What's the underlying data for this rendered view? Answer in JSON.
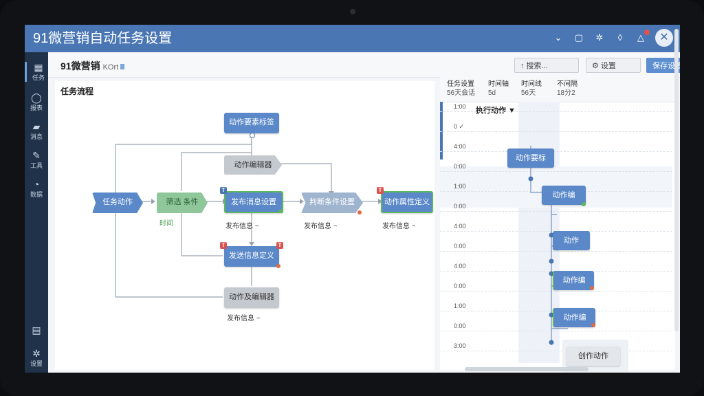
{
  "app": {
    "title": "91微营销自动任务设置"
  },
  "colors": {
    "titlebar": "#4a77b4",
    "node_blue": "#5a88c8",
    "node_gray": "#c4c9d0",
    "node_green": "#8fc79b",
    "sidebar": "#1f3249"
  },
  "titlebar_icons": [
    "chevron-down-icon",
    "tablet-icon",
    "settings-icon",
    "drop-icon",
    "bell-icon",
    "close-icon"
  ],
  "close_glyph": "✕",
  "sidebar": {
    "items": [
      {
        "icon": "▦",
        "label": "任务"
      },
      {
        "icon": "◯",
        "label": "报表"
      },
      {
        "icon": "▰",
        "label": "消息"
      },
      {
        "icon": "✎",
        "label": "工具"
      },
      {
        "icon": "◔",
        "label": "数据"
      }
    ],
    "bottom": [
      {
        "icon": "▤",
        "label": ""
      },
      {
        "icon": "✲",
        "label": "设置"
      }
    ]
  },
  "toolbar": {
    "breadcrumb": "91微营销",
    "breadcrumb_sub": "KOrt",
    "btn_search": "↑ 搜索...",
    "btn_settings": "⚙ 设置",
    "btn_save": "保存设置"
  },
  "flow": {
    "panel_title": "任务流程",
    "nodes": {
      "top": "动作要素标签",
      "mid_top": "动作编辑器",
      "start": "任务动作",
      "filter": "筛选 条件",
      "n1": "发布消息设置",
      "n2": "判断条件设置",
      "n3": "动作属性定义",
      "n4": "发送信息定义",
      "n5": "动作及编辑器"
    },
    "subs": {
      "filter": "时间",
      "n1": "发布信息 ~",
      "n2": "发布信息 ~",
      "n3": "发布信息 ~",
      "n5": "发布信息 ~"
    },
    "tags": {
      "n1": "T",
      "n3": "T",
      "n4a": "T",
      "n4b": "T"
    }
  },
  "timeline": {
    "headers": [
      {
        "k": "任务设置",
        "v": "56天会话"
      },
      {
        "k": "时间轴",
        "v": "5d"
      },
      {
        "k": "时间线",
        "v": "56天"
      },
      {
        "k": "不间隔",
        "v": "18分2"
      }
    ],
    "section": "执行动作 ▼",
    "rows": [
      "1:00",
      "0 ✓",
      "4:00",
      "0:00",
      "1:00",
      "0:00",
      "4:00",
      "0:00",
      "4:00",
      "0:00",
      "1:00",
      "0:00",
      "3:00"
    ],
    "nodes": [
      "动作要标",
      "动作编",
      "动作",
      "动作编",
      "动作编",
      "创作动作"
    ],
    "corner": "⊹ ⌄"
  }
}
